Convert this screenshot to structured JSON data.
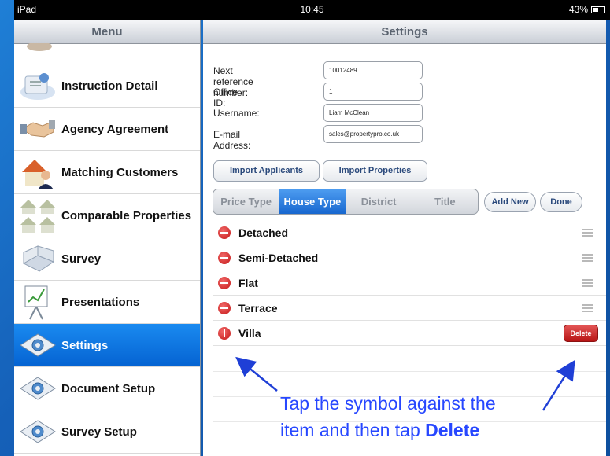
{
  "status_bar": {
    "device": "iPad",
    "time": "10:45",
    "battery": "43%"
  },
  "sidebar": {
    "title": "Menu",
    "items": [
      {
        "label": "Instruction Detail",
        "icon": "instruction-icon"
      },
      {
        "label": "Agency Agreement",
        "icon": "handshake-icon"
      },
      {
        "label": "Matching Customers",
        "icon": "house-person-icon"
      },
      {
        "label": "Comparable Properties",
        "icon": "houses-icon"
      },
      {
        "label": "Survey",
        "icon": "room-plan-icon"
      },
      {
        "label": "Presentations",
        "icon": "easel-chart-icon"
      },
      {
        "label": "Settings",
        "icon": "settings-icon",
        "active": true
      },
      {
        "label": "Document Setup",
        "icon": "settings-icon"
      },
      {
        "label": "Survey Setup",
        "icon": "settings-icon"
      }
    ]
  },
  "main": {
    "title": "Settings",
    "fields": [
      {
        "label": "Next reference number:",
        "value": "10012489"
      },
      {
        "label": "Office ID:",
        "value": "1"
      },
      {
        "label": "Username:",
        "value": "Liam McClean"
      },
      {
        "label": "E-mail Address:",
        "value": "sales@propertypro.co.uk"
      }
    ],
    "import_applicants": "Import Applicants",
    "import_properties": "Import Properties",
    "segments": [
      "Price Type",
      "House Type",
      "District",
      "Title"
    ],
    "selected_segment": "House Type",
    "add_new": "Add New",
    "done": "Done",
    "list": [
      "Detached",
      "Semi-Detached",
      "Flat",
      "Terrace",
      "Villa"
    ],
    "delete_label": "Delete"
  },
  "callout": {
    "line1": "Tap the symbol against the",
    "line2_prefix": "item and then tap ",
    "line2_strong": "Delete"
  },
  "colors": {
    "accent": "#0a6ee0",
    "delete": "#c41616",
    "callout": "#2747ff"
  }
}
